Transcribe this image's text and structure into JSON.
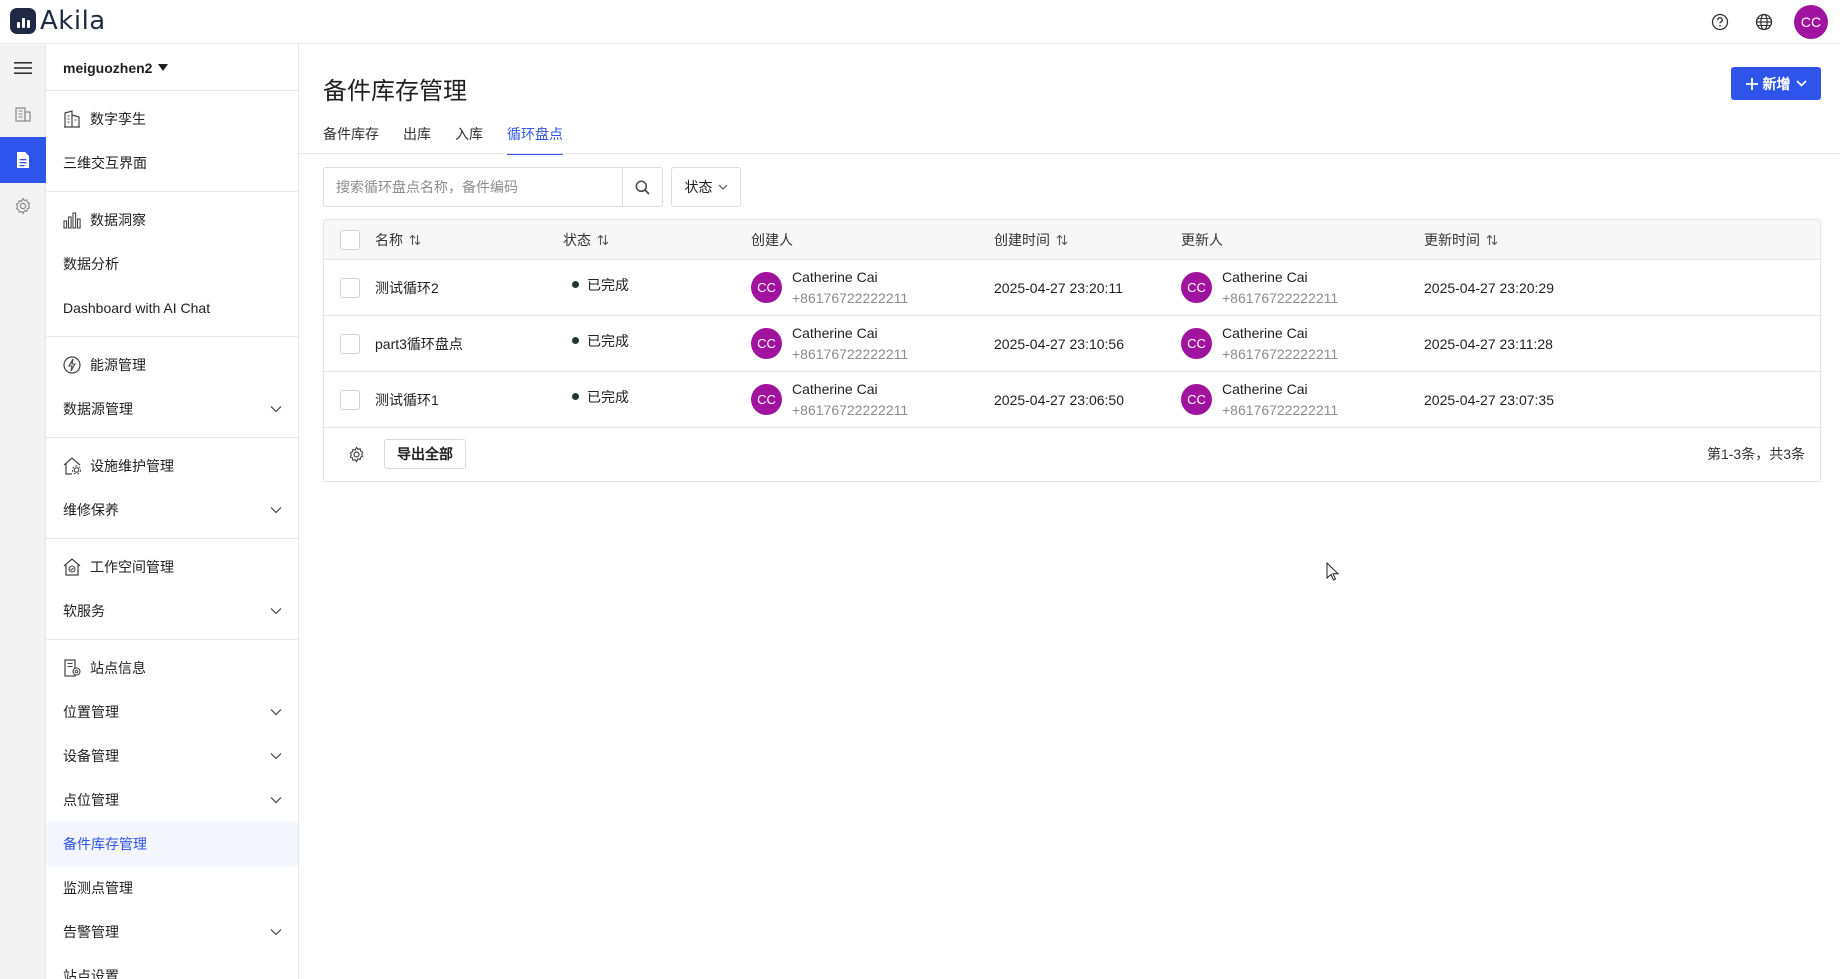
{
  "app": {
    "logo_text": "Akila",
    "user_initials": "CC"
  },
  "topbar": {
    "icons": [
      "help-icon",
      "globe-icon"
    ]
  },
  "sidebar": {
    "project": "meiguozhen2",
    "groups": [
      {
        "head": "数字孪生",
        "icon": "building-icon",
        "items": [
          {
            "label": "三维交互界面",
            "expandable": false
          }
        ]
      },
      {
        "head": "数据洞察",
        "icon": "bar-chart-icon",
        "items": [
          {
            "label": "数据分析",
            "expandable": false
          },
          {
            "label": "Dashboard with AI Chat",
            "expandable": false
          }
        ]
      },
      {
        "head": "能源管理",
        "icon": "energy-icon",
        "items": [
          {
            "label": "数据源管理",
            "expandable": true
          }
        ]
      },
      {
        "head": "设施维护管理",
        "icon": "house-gear-icon",
        "items": [
          {
            "label": "维修保养",
            "expandable": true
          }
        ]
      },
      {
        "head": "工作空间管理",
        "icon": "workspace-icon",
        "items": [
          {
            "label": "软服务",
            "expandable": true
          }
        ]
      },
      {
        "head": "站点信息",
        "icon": "site-icon",
        "items": [
          {
            "label": "位置管理",
            "expandable": true
          },
          {
            "label": "设备管理",
            "expandable": true
          },
          {
            "label": "点位管理",
            "expandable": true
          },
          {
            "label": "备件库存管理",
            "expandable": false,
            "active": true
          },
          {
            "label": "监测点管理",
            "expandable": false
          },
          {
            "label": "告警管理",
            "expandable": true
          },
          {
            "label": "站点设置",
            "expandable": false
          }
        ]
      }
    ]
  },
  "main": {
    "title": "备件库存管理",
    "new_button": "新增",
    "tabs": [
      {
        "label": "备件库存",
        "active": false
      },
      {
        "label": "出库",
        "active": false
      },
      {
        "label": "入库",
        "active": false
      },
      {
        "label": "循环盘点",
        "active": true
      }
    ],
    "search": {
      "placeholder": "搜索循环盘点名称，备件编码",
      "value": ""
    },
    "status_filter": "状态",
    "table": {
      "columns": [
        "名称",
        "状态",
        "创建人",
        "创建时间",
        "更新人",
        "更新时间"
      ],
      "rows": [
        {
          "name": "测试循环2",
          "status": "已完成",
          "creator": {
            "initials": "CC",
            "name": "Catherine Cai",
            "phone": "+86176722222211"
          },
          "created": "2025-04-27 23:20:11",
          "updater": {
            "initials": "CC",
            "name": "Catherine Cai",
            "phone": "+86176722222211"
          },
          "updated": "2025-04-27 23:20:29"
        },
        {
          "name": "part3循环盘点",
          "status": "已完成",
          "creator": {
            "initials": "CC",
            "name": "Catherine Cai",
            "phone": "+86176722222211"
          },
          "created": "2025-04-27 23:10:56",
          "updater": {
            "initials": "CC",
            "name": "Catherine Cai",
            "phone": "+86176722222211"
          },
          "updated": "2025-04-27 23:11:28"
        },
        {
          "name": "测试循环1",
          "status": "已完成",
          "creator": {
            "initials": "CC",
            "name": "Catherine Cai",
            "phone": "+86176722222211"
          },
          "created": "2025-04-27 23:06:50",
          "updater": {
            "initials": "CC",
            "name": "Catherine Cai",
            "phone": "+86176722222211"
          },
          "updated": "2025-04-27 23:07:35"
        }
      ],
      "export_button": "导出全部",
      "pagination": "第1-3条，共3条"
    }
  },
  "colors": {
    "accent": "#2f54eb",
    "avatar": "#a0139e"
  }
}
